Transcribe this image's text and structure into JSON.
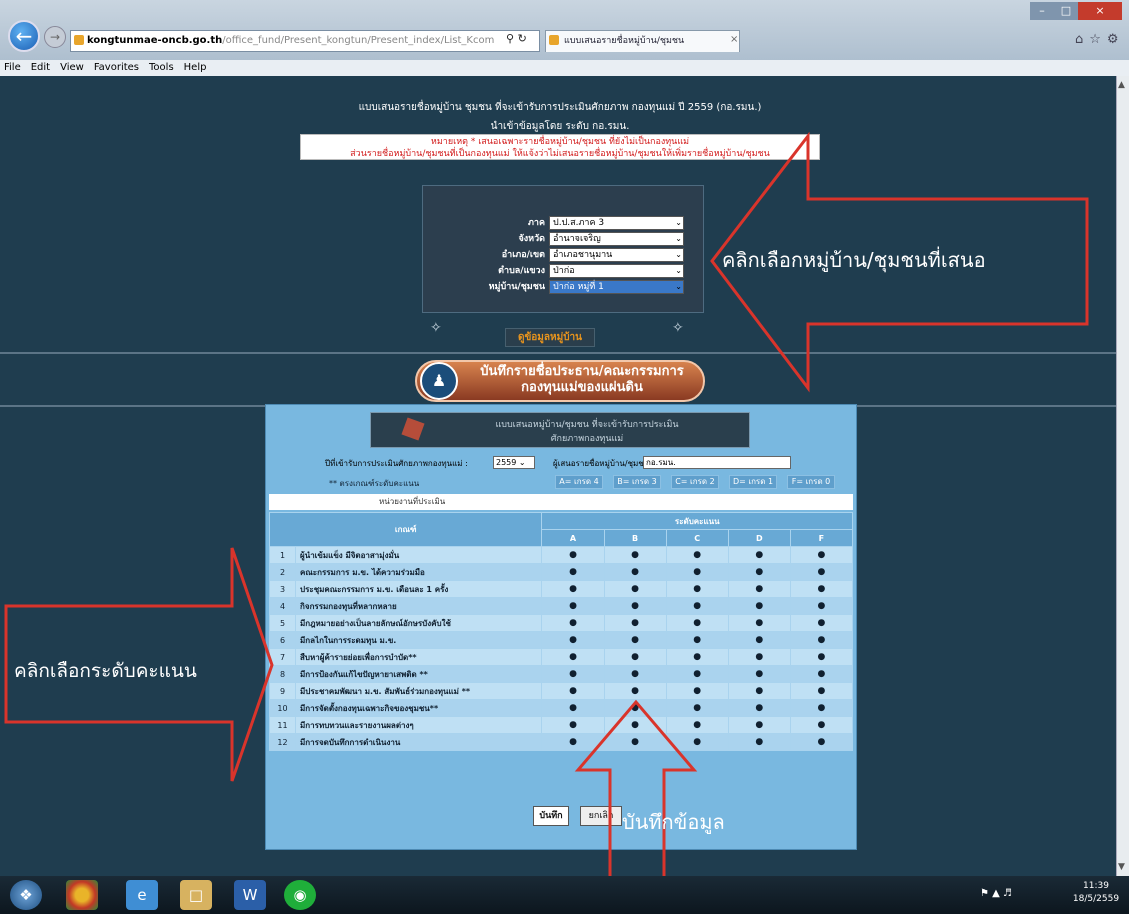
{
  "browser": {
    "url_domain": "kongtunmae-oncb.go.th",
    "url_rest": "/office_fund/Present_kongtun/Present_index/List_Kcom",
    "tab_title": "แบบเสนอรายชื่อหมู่บ้าน/ชุมชน",
    "menu": [
      "File",
      "Edit",
      "View",
      "Favorites",
      "Tools",
      "Help"
    ]
  },
  "header": {
    "title": "แบบเสนอรายชื่อหมู่บ้าน ชุมชน ที่จะเข้ารับการประเมินศักยภาพ กองทุนแม่ ปี 2559 (กอ.รมน.)",
    "subtitle": "นำเข้าข้อมูลโดย ระดับ กอ.รมน.",
    "note_line1": "หมายเหตุ * เสนอเฉพาะรายชื่อหมู่บ้าน/ชุมชน ที่ยังไม่เป็นกองทุนแม่",
    "note_line2": "ส่วนรายชื่อหมู่บ้าน/ชุมชนที่เป็นกองทุนแม่ ให้แจ้งว่าไม่เสนอรายชื่อหมู่บ้าน/ชุมชนให้เพิ่มรายชื่อหมู่บ้าน/ชุมชน"
  },
  "selectors": [
    {
      "label": "ภาค",
      "value": "ป.ป.ส.ภาค 3"
    },
    {
      "label": "จังหวัด",
      "value": "อำนาจเจริญ"
    },
    {
      "label": "อำเภอ/เขต",
      "value": "อำเภอชานุมาน"
    },
    {
      "label": "ตำบล/แขวง",
      "value": "ป่าก่อ"
    },
    {
      "label": "หมู่บ้าน/ชุมชน",
      "value": "ป่าก่อ หมู่ที่ 1"
    }
  ],
  "search_button": "ดูข้อมูลหมู่บ้าน",
  "record_button": {
    "line1": "บันทึกรายชื่อประธาน/คณะกรรมการ",
    "line2": "กองทุนแม่ของแผ่นดิน"
  },
  "form": {
    "head_line1": "แบบเสนอหมู่บ้าน/ชุมชน ที่จะเข้ารับการประเมิน",
    "head_line2": "ศักยภาพกองทุนแม่",
    "year_label": "ปีที่เข้ารับการประเมินศักยภาพกองทุนแม่ :",
    "year_value": "2559",
    "village_label": "ผู้เสนอรายชื่อหมู่บ้าน/ชุมชน",
    "village_value": "กอ.รมน.",
    "legend_label": "** ตรงเกณฑ์ระดับคะแนน",
    "legend": [
      "A= เกรด 4",
      "B= เกรด 3",
      "C= เกรด 2",
      "D= เกรด 1",
      "F= เกรด 0"
    ],
    "unit_row": "หน่วยงานที่ประเมิน",
    "col_criteria": "เกณฑ์",
    "col_level": "ระดับคะแนน",
    "levels": [
      "A",
      "B",
      "C",
      "D",
      "F"
    ],
    "rows": [
      {
        "no": "1",
        "text": "ผู้นำเข้มแข็ง มีจิตอาสามุ่งมั่น"
      },
      {
        "no": "2",
        "text": "คณะกรรมการ ม.ข. ได้ความร่วมมือ"
      },
      {
        "no": "3",
        "text": "ประชุมคณะกรรมการ ม.ข. เดือนละ 1 ครั้ง"
      },
      {
        "no": "4",
        "text": "กิจกรรมกองทุนที่หลากหลาย"
      },
      {
        "no": "5",
        "text": "มีกฎหมายอย่างเป็นลายลักษณ์อักษรบังคับใช้"
      },
      {
        "no": "6",
        "text": "มีกลไกในการระดมทุน ม.ข."
      },
      {
        "no": "7",
        "text": "สืบหาผู้ค้ารายย่อยเพื่อการบำบัด**"
      },
      {
        "no": "8",
        "text": "มีการป้องกันแก้ไขปัญหายาเสพติด **"
      },
      {
        "no": "9",
        "text": "มีประชาคมพัฒนา ม.ข. สัมพันธ์ร่วมกองทุนแม่ **"
      },
      {
        "no": "10",
        "text": "มีการจัดตั้งกองทุนเฉพาะกิจของชุมชน**"
      },
      {
        "no": "11",
        "text": "มีการทบทวนและรายงานผลต่างๆ"
      },
      {
        "no": "12",
        "text": "มีการจดบันทึกการดำเนินงาน"
      }
    ],
    "save_label": "บันทึก",
    "cancel_label": "ยกเลิก"
  },
  "annotations": {
    "pick_village": "คลิกเลือกหมู่บ้าน/ชุมชนที่เสนอ",
    "pick_score": "คลิกเลือกระดับคะแนน",
    "save_data": "บันทึกข้อมูล"
  },
  "taskbar": {
    "time": "11:39",
    "date": "18/5/2559"
  },
  "colors": {
    "page_bg": "#1f3d4f",
    "form_bg": "#79b8e0",
    "note_text": "#d21c1c",
    "arrow": "#d9342b"
  }
}
